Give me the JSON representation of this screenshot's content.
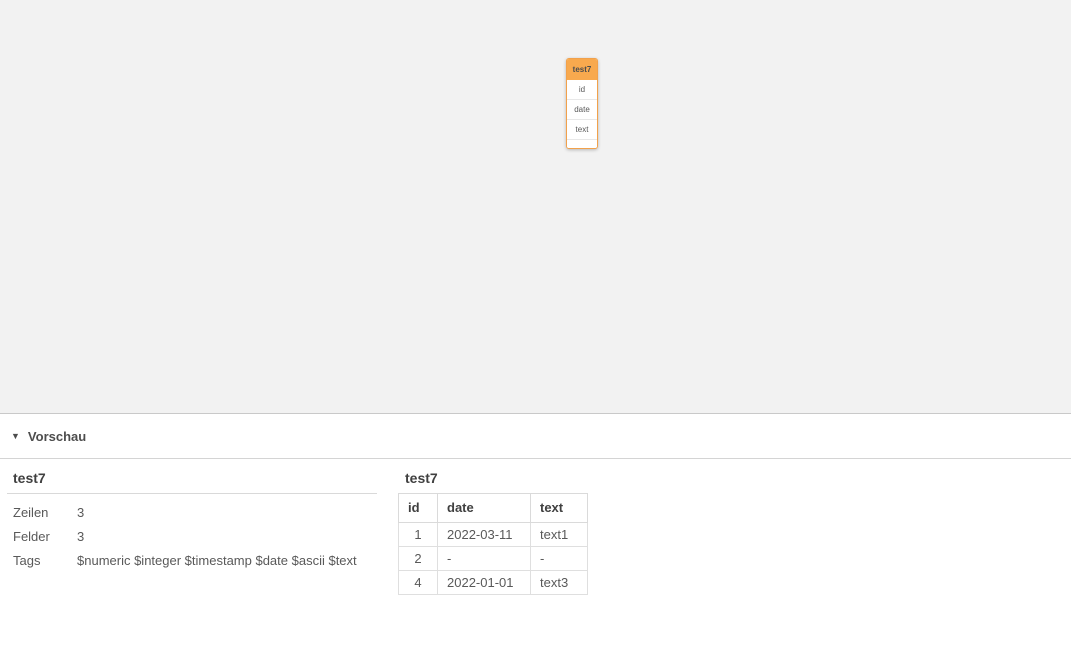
{
  "colors": {
    "canvas_bg": "#f2f2f2",
    "panel_bg": "#ffffff",
    "card_orange": "#f8a94e",
    "card_orange_border": "#f2a14b",
    "border_gray": "#d4d4d4",
    "text_primary": "#404040",
    "text_secondary": "#595959"
  },
  "canvas": {
    "table_card": {
      "title": "test7",
      "fields": [
        "id",
        "date",
        "text"
      ]
    }
  },
  "preview_bar": {
    "collapse_glyph": "▼",
    "label": "Vorschau"
  },
  "preview": {
    "info": {
      "title": "test7",
      "rows": [
        {
          "label": "Zeilen",
          "value": "3"
        },
        {
          "label": "Felder",
          "value": "3"
        },
        {
          "label": "Tags",
          "value": "$numeric $integer $timestamp $date $ascii $text"
        }
      ]
    },
    "table": {
      "title": "test7",
      "columns": [
        "id",
        "date",
        "text"
      ],
      "rows": [
        [
          "1",
          "2022-03-11",
          "text1"
        ],
        [
          "2",
          "-",
          "-"
        ],
        [
          "4",
          "2022-01-01",
          "text3"
        ]
      ]
    }
  }
}
